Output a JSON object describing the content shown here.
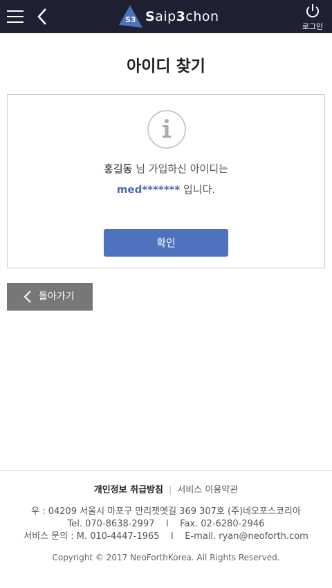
{
  "header": {
    "logo_badge": "S3",
    "logo_prefix": "S",
    "logo_mid": "aip",
    "logo_num": "3",
    "logo_suffix": "chon",
    "login_label": "로그인"
  },
  "page": {
    "title": "아이디 찾기"
  },
  "result": {
    "name": "홍길동",
    "line1_rest": " 님 가입하신 아이디는",
    "user_id": "med*******",
    "line2_rest": " 입니다.",
    "confirm_label": "확인"
  },
  "back": {
    "label": "돌아가기"
  },
  "footer": {
    "privacy": "개인정보 취급방침",
    "separator": "|",
    "terms": "서비스 이용약관",
    "address": "우 : 04209 서울시 마포구 만리잿옛길 369 307호 (주)네오포스코리아",
    "contact1": "Tel. 070-8638-2997    l    Fax. 02-6280-2946",
    "contact2": "서비스 문의 : M. 010-4447-1965    l    E-mail. ryan@neoforth.com",
    "copyright": "Copyright © 2017 NeoForthKorea. All Rights Reserved."
  },
  "colors": {
    "header_bg": "#1f2133",
    "accent": "#4e72be",
    "back_button_bg": "#777777"
  }
}
